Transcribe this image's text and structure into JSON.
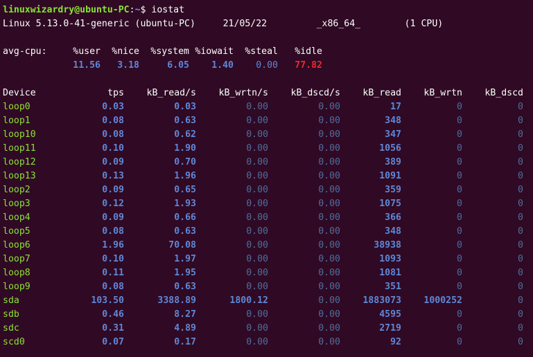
{
  "prompt": {
    "user_host": "linuxwizardry@ubuntu-PC",
    "sep": ":",
    "path": "~",
    "dollar": "$ ",
    "command": "iostat"
  },
  "sysinfo": {
    "kernel": "Linux 5.13.0-41-generic (ubuntu-PC)",
    "date": "21/05/22",
    "arch": "_x86_64_",
    "cpus": "(1 CPU)"
  },
  "cpu": {
    "label": "avg-cpu:",
    "headers": [
      "%user",
      "%nice",
      "%system",
      "%iowait",
      "%steal",
      "%idle"
    ],
    "values": [
      "11.56",
      "3.18",
      "6.05",
      "1.40",
      "0.00",
      "77.82"
    ]
  },
  "devices": {
    "headers": [
      "Device",
      "tps",
      "kB_read/s",
      "kB_wrtn/s",
      "kB_dscd/s",
      "kB_read",
      "kB_wrtn",
      "kB_dscd"
    ],
    "rows": [
      [
        "loop0",
        "0.03",
        "0.03",
        "0.00",
        "0.00",
        "17",
        "0",
        "0"
      ],
      [
        "loop1",
        "0.08",
        "0.63",
        "0.00",
        "0.00",
        "348",
        "0",
        "0"
      ],
      [
        "loop10",
        "0.08",
        "0.62",
        "0.00",
        "0.00",
        "347",
        "0",
        "0"
      ],
      [
        "loop11",
        "0.10",
        "1.90",
        "0.00",
        "0.00",
        "1056",
        "0",
        "0"
      ],
      [
        "loop12",
        "0.09",
        "0.70",
        "0.00",
        "0.00",
        "389",
        "0",
        "0"
      ],
      [
        "loop13",
        "0.13",
        "1.96",
        "0.00",
        "0.00",
        "1091",
        "0",
        "0"
      ],
      [
        "loop2",
        "0.09",
        "0.65",
        "0.00",
        "0.00",
        "359",
        "0",
        "0"
      ],
      [
        "loop3",
        "0.12",
        "1.93",
        "0.00",
        "0.00",
        "1075",
        "0",
        "0"
      ],
      [
        "loop4",
        "0.09",
        "0.66",
        "0.00",
        "0.00",
        "366",
        "0",
        "0"
      ],
      [
        "loop5",
        "0.08",
        "0.63",
        "0.00",
        "0.00",
        "348",
        "0",
        "0"
      ],
      [
        "loop6",
        "1.96",
        "70.08",
        "0.00",
        "0.00",
        "38938",
        "0",
        "0"
      ],
      [
        "loop7",
        "0.10",
        "1.97",
        "0.00",
        "0.00",
        "1093",
        "0",
        "0"
      ],
      [
        "loop8",
        "0.11",
        "1.95",
        "0.00",
        "0.00",
        "1081",
        "0",
        "0"
      ],
      [
        "loop9",
        "0.08",
        "0.63",
        "0.00",
        "0.00",
        "351",
        "0",
        "0"
      ],
      [
        "sda",
        "103.50",
        "3388.89",
        "1800.12",
        "0.00",
        "1883073",
        "1000252",
        "0"
      ],
      [
        "sdb",
        "0.46",
        "8.27",
        "0.00",
        "0.00",
        "4595",
        "0",
        "0"
      ],
      [
        "sdc",
        "0.31",
        "4.89",
        "0.00",
        "0.00",
        "2719",
        "0",
        "0"
      ],
      [
        "scd0",
        "0.07",
        "0.17",
        "0.00",
        "0.00",
        "92",
        "0",
        "0"
      ]
    ]
  },
  "colors": {
    "background": "#300a24",
    "prompt_user": "#8ae234",
    "prompt_path": "#729fcf",
    "value": "#5f87d7",
    "idle_value": "#ef2929",
    "device_name": "#8ae234"
  }
}
